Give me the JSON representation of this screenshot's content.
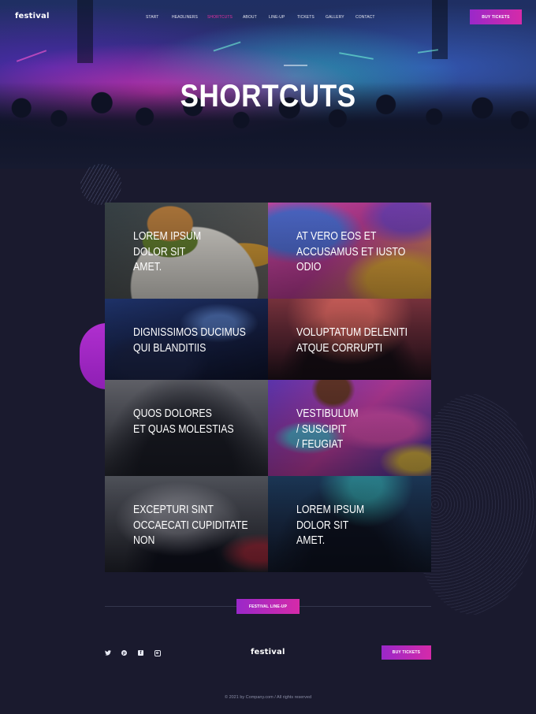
{
  "brand": "festival",
  "nav": {
    "items": [
      {
        "label": "START",
        "active": false
      },
      {
        "label": "HEADLINERS",
        "active": false
      },
      {
        "label": "SHORTCUTS",
        "active": true
      },
      {
        "label": "ABOUT",
        "active": false
      },
      {
        "label": "LINE-UP",
        "active": false
      },
      {
        "label": "TICKETS",
        "active": false
      },
      {
        "label": "GALLERY",
        "active": false
      },
      {
        "label": "CONTACT",
        "active": false
      }
    ],
    "buy_tickets": "BUY TICKETS"
  },
  "hero": {
    "title": "SHORTCUTS"
  },
  "shortcuts": [
    {
      "label": "LOREM IPSUM\nDOLOR SIT\nAMET."
    },
    {
      "label": "AT VERO EOS ET\nACCUSAMUS ET IUSTO\nODIO"
    },
    {
      "label": "DIGNISSIMOS DUCIMUS\nQUI BLANDITIIS"
    },
    {
      "label": "VOLUPTATUM DELENITI\nATQUE CORRUPTI"
    },
    {
      "label": "QUOS DOLORES\nET QUAS MOLESTIAS"
    },
    {
      "label": "VESTIBULUM\n/ SUSCIPIT\n/ FEUGIAT"
    },
    {
      "label": "EXCEPTURI SINT\nOCCAECATI CUPIDITATE\nNON"
    },
    {
      "label": "LOREM IPSUM\nDOLOR SIT\nAMET."
    }
  ],
  "lineup_button": "FESTIVAL LINE-UP",
  "footer": {
    "brand": "festival",
    "social": [
      "twitter-icon",
      "pinterest-icon",
      "facebook-icon",
      "instagram-icon"
    ],
    "buy_tickets": "BUY TICKETS",
    "copyright": "©  2021 by Company.com  /  All rights reserved"
  },
  "colors": {
    "background": "#1a1a2e",
    "accent": "#d52aa9",
    "accent_alt": "#9a28c9",
    "nav_active": "#e6309f"
  }
}
